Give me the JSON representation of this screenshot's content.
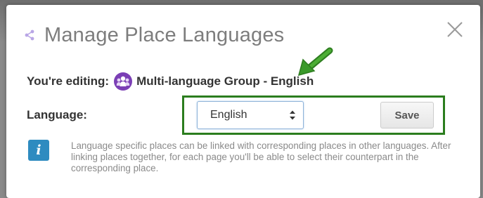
{
  "dialog": {
    "title": "Manage Place Languages",
    "share_icon": "share-icon",
    "close_icon": "close-icon"
  },
  "editing": {
    "label": "You're editing:",
    "group_icon": "group-people-icon",
    "group_name": "Multi-language Group - English"
  },
  "language": {
    "label": "Language:",
    "selected": "English"
  },
  "save": {
    "label": "Save"
  },
  "info": {
    "icon_glyph": "i",
    "text": "Language specific places can be linked with corresponding places in other languages. After linking places together, for each page you'll be able to select their counterpart in the corresponding place."
  },
  "colors": {
    "highlight_green": "#2b7d1e",
    "arrow_green": "#3a9a2a",
    "info_blue": "#2e8bc0",
    "group_icon_purple": "#7b3fb5"
  }
}
